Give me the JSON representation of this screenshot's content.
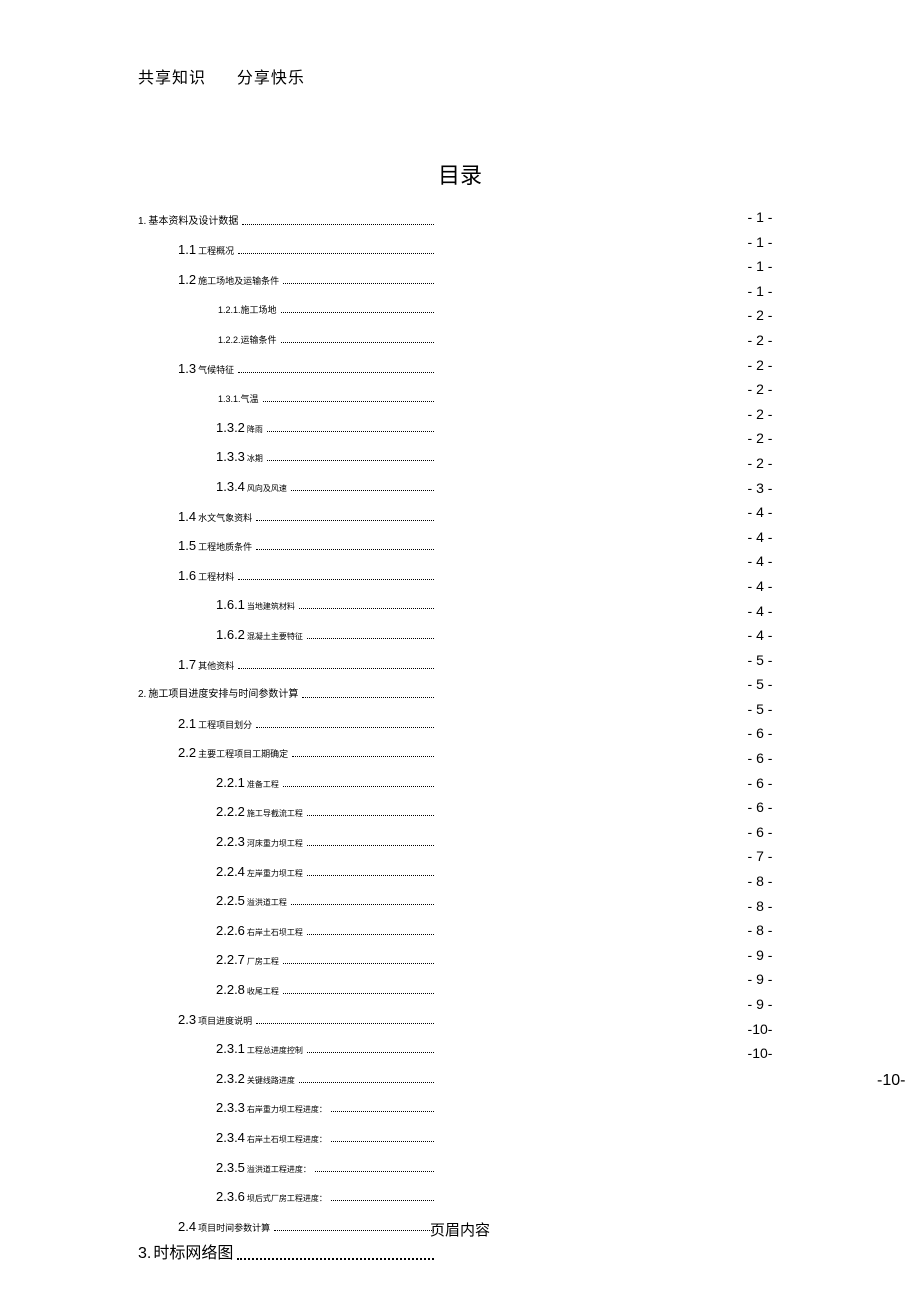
{
  "header": {
    "left": "共享知识",
    "right": "分享快乐"
  },
  "title": "目录",
  "footer": "页眉内容",
  "extra_page": "-10-",
  "toc": [
    {
      "level": "lvl-0",
      "num": "1.",
      "text": "基本资料及设计数据",
      "page": "- 1 -",
      "dotw": 290
    },
    {
      "level": "lvl-1",
      "num": "1.1",
      "text": "工程概况",
      "page": "- 1 -",
      "dotw": 290
    },
    {
      "level": "lvl-1",
      "num": "1.2",
      "text": "施工场地及运输条件",
      "page": "- 1 -",
      "dotw": 290
    },
    {
      "level": "lvl-2",
      "num": "",
      "text": "1.2.1.施工场地",
      "page": "- 1 -",
      "dotw": 290
    },
    {
      "level": "lvl-2",
      "num": "",
      "text": "1.2.2.运输条件",
      "page": "- 2 -",
      "dotw": 290
    },
    {
      "level": "lvl-1",
      "num": "1.3",
      "text": "气候特征",
      "page": "- 2 -",
      "dotw": 290
    },
    {
      "level": "lvl-2",
      "num": "",
      "text": "1.3.1.气温",
      "page": "- 2 -",
      "dotw": 290
    },
    {
      "level": "lvl-2b",
      "num": "1.3.2",
      "text": "降雨",
      "page": "- 2 -",
      "dotw": 290
    },
    {
      "level": "lvl-2b",
      "num": "1.3.3",
      "text": "冰期",
      "page": "- 2 -",
      "dotw": 290
    },
    {
      "level": "lvl-2b",
      "num": "1.3.4",
      "text": "风向及风速",
      "page": "- 2 -",
      "dotw": 290
    },
    {
      "level": "lvl-1",
      "num": "1.4",
      "text": "水文气象资料",
      "page": "- 2 -",
      "dotw": 290
    },
    {
      "level": "lvl-1",
      "num": "1.5",
      "text": "工程地质条件",
      "page": "- 3 -",
      "dotw": 290
    },
    {
      "level": "lvl-1",
      "num": "1.6",
      "text": "工程材料",
      "page": "- 4 -",
      "dotw": 290
    },
    {
      "level": "lvl-2b",
      "num": "1.6.1",
      "text": "当地建筑材料",
      "page": "- 4 -",
      "dotw": 290
    },
    {
      "level": "lvl-2b",
      "num": "1.6.2",
      "text": "混凝土主要特征",
      "page": "- 4 -",
      "dotw": 290
    },
    {
      "level": "lvl-1",
      "num": "1.7",
      "text": "其他资料",
      "page": "- 4 -",
      "dotw": 290
    },
    {
      "level": "lvl-0",
      "num": "2.",
      "text": "施工项目进度安排与时间参数计算",
      "page": "- 4 -",
      "dotw": 290
    },
    {
      "level": "lvl-1",
      "num": "2.1",
      "text": "工程项目划分",
      "page": "- 4 -",
      "dotw": 290
    },
    {
      "level": "lvl-1",
      "num": "2.2",
      "text": "主要工程项目工期确定",
      "page": "- 5 -",
      "dotw": 290
    },
    {
      "level": "lvl-2b",
      "num": "2.2.1",
      "text": "准备工程",
      "page": "- 5 -",
      "dotw": 290
    },
    {
      "level": "lvl-2b",
      "num": "2.2.2",
      "text": "施工导截流工程",
      "page": "- 5 -",
      "dotw": 290
    },
    {
      "level": "lvl-2b",
      "num": "2.2.3",
      "text": "河床重力坝工程",
      "page": "- 6 -",
      "dotw": 290
    },
    {
      "level": "lvl-2b",
      "num": "2.2.4",
      "text": "左岸重力坝工程",
      "page": "- 6 -",
      "dotw": 290
    },
    {
      "level": "lvl-2b",
      "num": "2.2.5",
      "text": "溢洪道工程",
      "page": "- 6 -",
      "dotw": 290
    },
    {
      "level": "lvl-2b",
      "num": "2.2.6",
      "text": "右岸土石坝工程",
      "page": "- 6 -",
      "dotw": 290
    },
    {
      "level": "lvl-2b",
      "num": "2.2.7",
      "text": "厂房工程",
      "page": "- 6 -",
      "dotw": 290
    },
    {
      "level": "lvl-2b",
      "num": "2.2.8",
      "text": "收尾工程",
      "page": "- 7 -",
      "dotw": 290
    },
    {
      "level": "lvl-1",
      "num": "2.3",
      "text": "项目进度说明",
      "page": "- 8 -",
      "dotw": 290
    },
    {
      "level": "lvl-2b",
      "num": "2.3.1",
      "text": "工程总进度控制",
      "page": "- 8 -",
      "dotw": 290
    },
    {
      "level": "lvl-2b",
      "num": "2.3.2",
      "text": "关键线路进度",
      "page": "- 8 -",
      "dotw": 290
    },
    {
      "level": "lvl-2b",
      "num": "2.3.3",
      "text": "右岸重力坝工程进度：",
      "page": "- 9 -",
      "dotw": 290
    },
    {
      "level": "lvl-2b",
      "num": "2.3.4",
      "text": "右岸土石坝工程进度：",
      "page": "- 9 -",
      "dotw": 290
    },
    {
      "level": "lvl-2b",
      "num": "2.3.5",
      "text": "溢洪道工程进度：",
      "page": "- 9 -",
      "dotw": 290
    },
    {
      "level": "lvl-2b",
      "num": "2.3.6",
      "text": "坝后式厂房工程进度：",
      "page": "-10-",
      "dotw": 290
    },
    {
      "level": "lvl-1",
      "num": "2.4",
      "text": "项目时间参数计算",
      "page": "-10-",
      "dotw": 290
    },
    {
      "level": "special-3",
      "num": "3.",
      "text": "时标网络图",
      "page": "",
      "dotw": 290
    }
  ]
}
